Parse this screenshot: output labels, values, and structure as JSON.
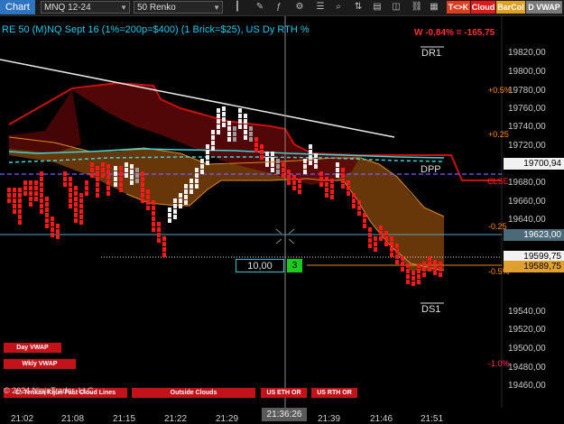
{
  "toolbar": {
    "chart_tab": "Chart",
    "instrument": "MNQ 12-24",
    "bars": "50 Renko",
    "buttons": [
      {
        "label": "T<>K",
        "color": "#e03c1e"
      },
      {
        "label": "Cloud",
        "color": "#e01818"
      },
      {
        "label": "BarCol",
        "color": "#e0a020"
      },
      {
        "label": "D VWAP",
        "color": "#7a7a7a"
      }
    ]
  },
  "title": "RE 50 (M)NQ Sept 16 (1%=200p=$400) (1 Brick=$25), US Dy RTH %",
  "week_stat": "W -0,84% = -165,75",
  "price_axis": [
    "19820,00",
    "19800,00",
    "19780,00",
    "19760,00",
    "19740,00",
    "19720,00",
    "19680,00",
    "19660,00",
    "19640,00",
    "19540,00",
    "19520,00",
    "19500,00",
    "19480,00",
    "19460,00"
  ],
  "pct_levels": [
    {
      "text": "+0.5%",
      "color": "#ff8c00"
    },
    {
      "text": "+0.25",
      "color": "#ff8c00"
    },
    {
      "text": "CLSE",
      "color": "#ff2020"
    },
    {
      "text": "-0.25",
      "color": "#ff8c00"
    },
    {
      "text": "-0.5%",
      "color": "#ff8c00"
    },
    {
      "text": "-1.0%",
      "color": "#ff3060"
    }
  ],
  "price_boxes": {
    "current": "19700,94",
    "cyan": "19623,00",
    "cross": "19599,75",
    "orange": "19589,75"
  },
  "levels": {
    "dr1": "DR1",
    "dpp": "DPP",
    "ds1": "DS1"
  },
  "ruler": {
    "value": "10,00",
    "bricks": "3"
  },
  "buttons": {
    "day_vwap": "Day VWAP",
    "wkly_vwap": "Wkly VWAP"
  },
  "bottom_bar": [
    "C: Tenkan Kijun Fast Cloud Lines",
    "Outside Clouds",
    "US ETH OR",
    "US RTH OR"
  ],
  "copyright": "© 2024 NinjaTrader, LLC",
  "time_axis": [
    "21:02",
    "21:08",
    "21:15",
    "21:22",
    "21:29",
    "21:39",
    "21:46",
    "21:51"
  ],
  "crosshair_time": "21:36:26"
}
